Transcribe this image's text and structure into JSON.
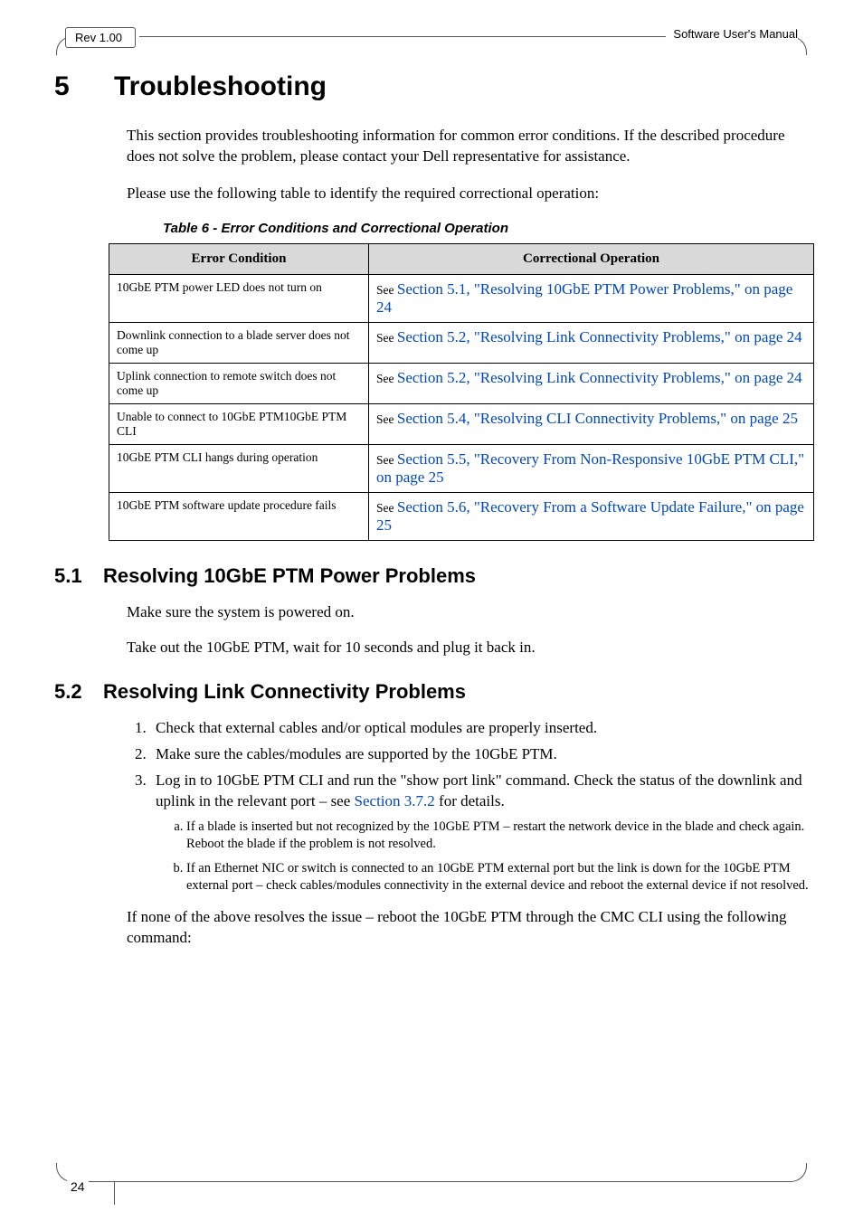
{
  "header": {
    "rev": "Rev 1.00",
    "doc_title": "Software User's Manual"
  },
  "chapter": {
    "number": "5",
    "title": "Troubleshooting",
    "intro_p1": "This section provides troubleshooting information for common error conditions. If the described procedure does not solve the problem, please contact your Dell representative for assistance.",
    "intro_p2": "Please use the following table to identify the required correctional operation:"
  },
  "table": {
    "caption": "Table 6 - Error Conditions and Correctional Operation",
    "header_left": "Error Condition",
    "header_right": "Correctional Operation",
    "rows": [
      {
        "condition": "10GbE PTM power LED does not turn on",
        "see": "See ",
        "link": "Section 5.1, \"Resolving 10GbE PTM Power Problems,\" on page 24"
      },
      {
        "condition": "Downlink connection to a blade server does not come up",
        "see": "See ",
        "link": "Section 5.2, \"Resolving Link Connectivity Problems,\" on page 24"
      },
      {
        "condition": "Uplink connection to remote switch does not come up",
        "see": "See ",
        "link": "Section 5.2, \"Resolving Link Connectivity Problems,\" on page 24"
      },
      {
        "condition": "Unable to connect to 10GbE PTM10GbE PTM CLI",
        "see": "See ",
        "link": "Section 5.4, \"Resolving CLI Connectivity Problems,\" on page 25"
      },
      {
        "condition": "10GbE PTM CLI hangs during operation",
        "see": "See ",
        "link": "Section 5.5, \"Recovery From Non-Responsive 10GbE PTM CLI,\" on page 25"
      },
      {
        "condition": "10GbE PTM software update procedure fails",
        "see": "See ",
        "link": "Section 5.6, \"Recovery From a Software Update Failure,\" on page 25"
      }
    ]
  },
  "section_5_1": {
    "number": "5.1",
    "title": "Resolving 10GbE PTM Power Problems",
    "p1": "Make sure the system is powered on.",
    "p2": "Take out the 10GbE PTM, wait for 10 seconds and plug it back in."
  },
  "section_5_2": {
    "number": "5.2",
    "title": "Resolving Link Connectivity Problems",
    "items": [
      "Check that external cables and/or optical modules are properly inserted.",
      "Make sure the cables/modules are supported by the 10GbE PTM."
    ],
    "item3_pre": "Log in to 10GbE PTM CLI and run the \"show port link\" command. Check the status of the downlink and uplink in the relevant port – see ",
    "item3_link": "Section 3.7.2",
    "item3_post": " for details.",
    "subitems": [
      "If a blade is inserted but not recognized by the 10GbE PTM – restart the network device in the blade and check again. Reboot the blade if the problem is not resolved.",
      "If an Ethernet NIC or switch is connected to an 10GbE PTM external port but the link is down for the 10GbE PTM external port – check cables/modules connectivity in the external device and reboot the external device if not resolved."
    ],
    "closing": "If none of the above resolves the issue – reboot the 10GbE PTM through the CMC CLI using the following command:"
  },
  "footer": {
    "page": "24"
  }
}
